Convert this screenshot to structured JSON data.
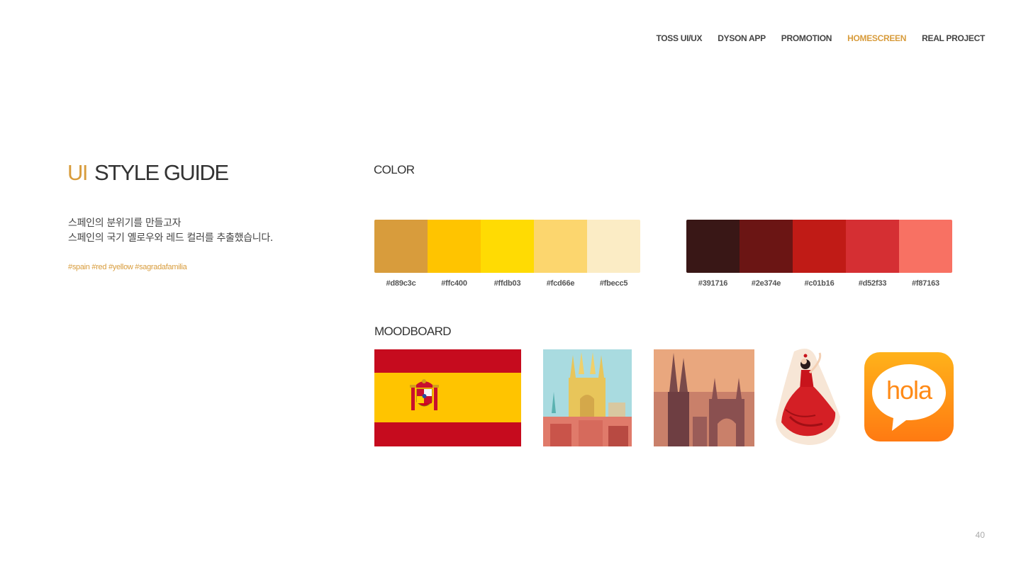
{
  "nav": {
    "items": [
      {
        "label": "TOSS UI/UX",
        "active": false
      },
      {
        "label": "DYSON APP",
        "active": false
      },
      {
        "label": "PROMOTION",
        "active": false
      },
      {
        "label": "HOMESCREEN",
        "active": true
      },
      {
        "label": "REAL PROJECT",
        "active": false
      }
    ]
  },
  "title": {
    "accent": "UI",
    "main": "STYLE GUIDE"
  },
  "description": {
    "line1": "스페인의 분위기를 만들고자",
    "line2": "스페인의 국기 옐로우와 레드 컬러를 추출했습니다."
  },
  "tags": "#spain #red #yellow #sagradafamilia",
  "color_section": {
    "title": "COLOR",
    "yellow_palette": [
      {
        "hex": "#d89c3c",
        "label": "#d89c3c"
      },
      {
        "hex": "#ffc400",
        "label": "#ffc400"
      },
      {
        "hex": "#ffdb03",
        "label": "#ffdb03"
      },
      {
        "hex": "#fcd66e",
        "label": "#fcd66e"
      },
      {
        "hex": "#fbecc5",
        "label": "#fbecc5"
      }
    ],
    "red_palette": [
      {
        "hex": "#391716",
        "label": "#391716"
      },
      {
        "hex": "#6b1514",
        "label": "#2e374e"
      },
      {
        "hex": "#c01b16",
        "label": "#c01b16"
      },
      {
        "hex": "#d52f33",
        "label": "#d52f33"
      },
      {
        "hex": "#f87163",
        "label": "#f87163"
      }
    ]
  },
  "moodboard": {
    "title": "MOODBOARD",
    "hola_text": "hola"
  },
  "page_number": "40"
}
